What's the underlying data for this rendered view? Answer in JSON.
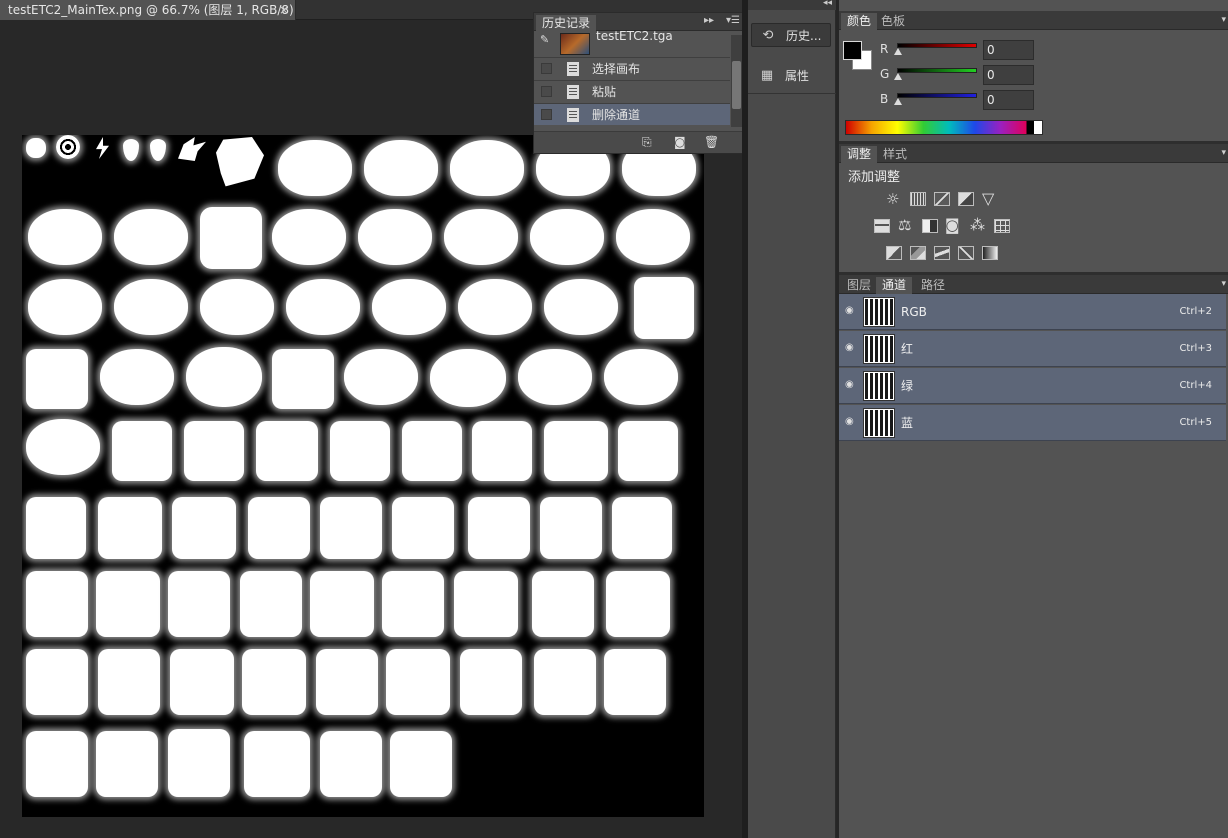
{
  "document": {
    "tab_title": "testETC2_MainTex.png @ 66.7% (图层 1, RGB/8) *",
    "close_glyph": "×"
  },
  "history_panel": {
    "tab_label": "历史记录",
    "snapshot_name": "testETC2.tga",
    "items": [
      {
        "label": "选择画布"
      },
      {
        "label": "粘贴"
      },
      {
        "label": "删除通道"
      }
    ]
  },
  "collapsed_dock": {
    "items": [
      {
        "label": "历史...",
        "icon": "history-icon"
      },
      {
        "label": "属性",
        "icon": "properties-icon"
      }
    ]
  },
  "color_panel": {
    "tabs": [
      "颜色",
      "色板"
    ],
    "channels": [
      {
        "label": "R",
        "value": "0",
        "color": "#d00000"
      },
      {
        "label": "G",
        "value": "0",
        "color": "#1eb41e"
      },
      {
        "label": "B",
        "value": "0",
        "color": "#1a1ad6"
      }
    ],
    "foreground_color": "#000000",
    "background_color": "#ffffff"
  },
  "adjustments_panel": {
    "tabs": [
      "调整",
      "样式"
    ],
    "heading": "添加调整",
    "icons": [
      "brightness-contrast-icon",
      "levels-icon",
      "curves-icon",
      "exposure-icon",
      "vibrance-icon",
      "hue-saturation-icon",
      "color-balance-icon",
      "black-white-icon",
      "photo-filter-icon",
      "channel-mixer-icon",
      "color-lookup-icon",
      "invert-icon",
      "posterize-icon",
      "threshold-icon",
      "selective-color-icon",
      "gradient-map-icon"
    ]
  },
  "layers_panel": {
    "tabs": [
      "图层",
      "通道",
      "路径"
    ],
    "channels": [
      {
        "name": "RGB",
        "shortcut": "Ctrl+2"
      },
      {
        "name": "红",
        "shortcut": "Ctrl+3"
      },
      {
        "name": "绿",
        "shortcut": "Ctrl+4"
      },
      {
        "name": "蓝",
        "shortcut": "Ctrl+5"
      }
    ]
  }
}
